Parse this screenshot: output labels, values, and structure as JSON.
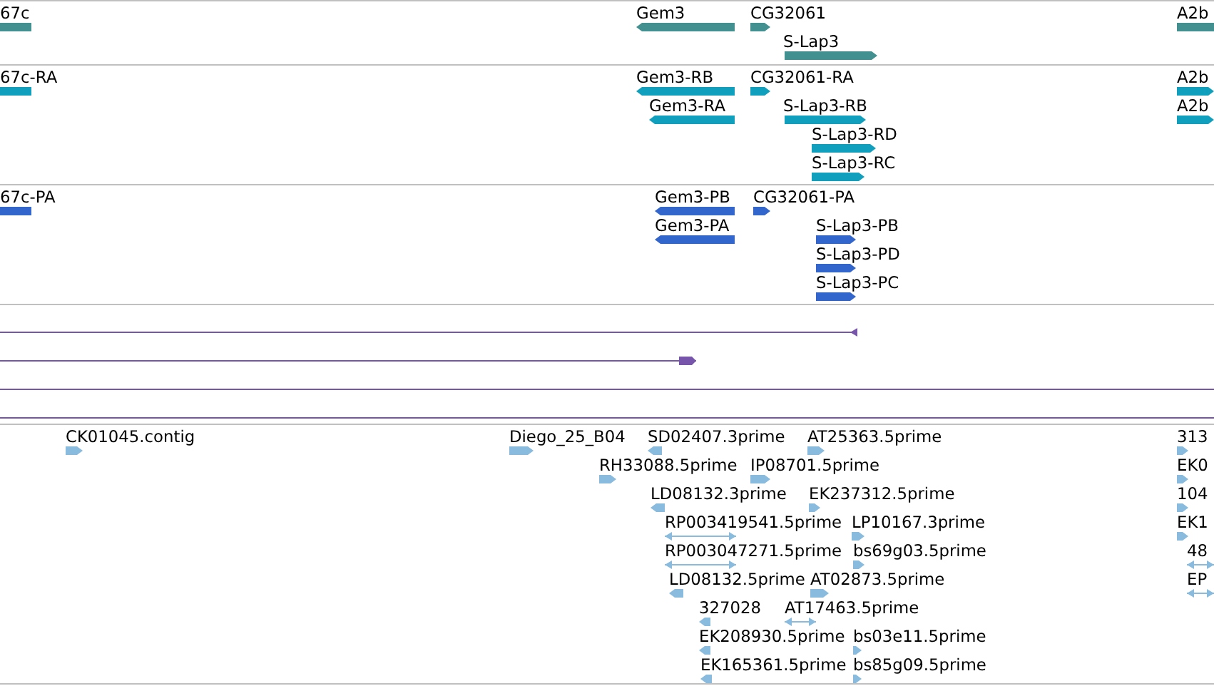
{
  "tracks": [
    {
      "kind": "genes",
      "color": "#42908f",
      "features": [
        {
          "label": "67c",
          "kind": "none"
        },
        {
          "label": "Gem3",
          "kind": "minus"
        },
        {
          "label": "CG32061",
          "kind": "plus"
        },
        {
          "label": "S-Lap3",
          "kind": "plus"
        },
        {
          "label": "A2b",
          "kind": "none"
        }
      ]
    },
    {
      "kind": "genes",
      "color": "#10a0bd",
      "features": [
        {
          "label": "67c-RA",
          "kind": "none"
        },
        {
          "label": "Gem3-RB",
          "kind": "minus"
        },
        {
          "label": "Gem3-RA",
          "kind": "minus"
        },
        {
          "label": "CG32061-RA",
          "kind": "plus"
        },
        {
          "label": "S-Lap3-RB",
          "kind": "plus"
        },
        {
          "label": "S-Lap3-RD",
          "kind": "plus"
        },
        {
          "label": "S-Lap3-RC",
          "kind": "plus"
        },
        {
          "label": "A2b",
          "kind": "plus"
        },
        {
          "label": "A2b",
          "kind": "plus"
        }
      ]
    },
    {
      "kind": "genes",
      "color": "#3366cc",
      "features": [
        {
          "label": "67c-PA",
          "kind": "none"
        },
        {
          "label": "Gem3-PB",
          "kind": "minus"
        },
        {
          "label": "Gem3-PA",
          "kind": "minus"
        },
        {
          "label": "CG32061-PA",
          "kind": "plus"
        },
        {
          "label": "S-Lap3-PB",
          "kind": "plus"
        },
        {
          "label": "S-Lap3-PD",
          "kind": "plus"
        },
        {
          "label": "S-Lap3-PC",
          "kind": "plus"
        }
      ]
    },
    {
      "kind": "lines",
      "color": "#7755aa",
      "features": [
        {
          "kind": "minus"
        },
        {
          "kind": "plus"
        },
        {
          "kind": "none"
        },
        {
          "kind": "none"
        }
      ]
    },
    {
      "kind": "genes",
      "color": "#88bbdd",
      "features": [
        {
          "label": "CK01045.contig",
          "kind": "plus"
        },
        {
          "label": "Diego_25_B04",
          "kind": "plus"
        },
        {
          "label": "SD02407.3prime",
          "kind": "minus"
        },
        {
          "label": "AT25363.5prime",
          "kind": "plus"
        },
        {
          "label": "313",
          "kind": "plus"
        },
        {
          "label": "RH33088.5prime",
          "kind": "plus"
        },
        {
          "label": "IP08701.5prime",
          "kind": "plus"
        },
        {
          "label": "EK0",
          "kind": "plus"
        },
        {
          "label": "LD08132.3prime",
          "kind": "minus"
        },
        {
          "label": "EK237312.5prime",
          "kind": "plus"
        },
        {
          "label": "104",
          "kind": "plus"
        },
        {
          "label": "RP003419541.5prime",
          "kind": "both"
        },
        {
          "label": "LP10167.3prime",
          "kind": "plus"
        },
        {
          "label": "EK1",
          "kind": "plus"
        },
        {
          "label": "RP003047271.5prime",
          "kind": "both"
        },
        {
          "label": "bs69g03.5prime",
          "kind": "plus"
        },
        {
          "label": "48",
          "kind": "both"
        },
        {
          "label": "LD08132.5prime",
          "kind": "minus"
        },
        {
          "label": "AT02873.5prime",
          "kind": "plus"
        },
        {
          "label": "EP",
          "kind": "both"
        },
        {
          "label": "327028",
          "kind": "minus"
        },
        {
          "label": "AT17463.5prime",
          "kind": "both"
        },
        {
          "label": "EK208930.5prime",
          "kind": "minus"
        },
        {
          "label": "bs03e11.5prime",
          "kind": "plus"
        },
        {
          "label": "EK165361.5prime",
          "kind": "minus"
        },
        {
          "label": "bs85g09.5prime",
          "kind": "plus"
        }
      ]
    }
  ]
}
